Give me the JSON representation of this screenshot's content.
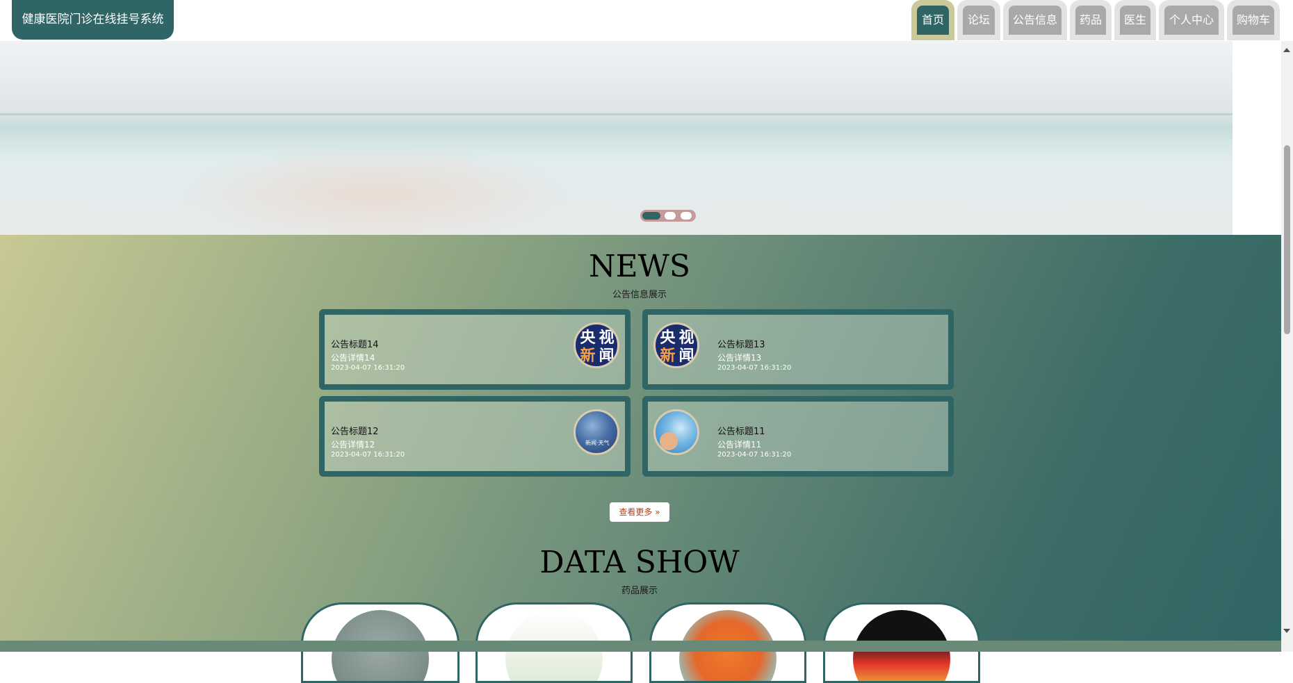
{
  "header": {
    "brand": "健康医院门诊在线挂号系统",
    "nav": [
      {
        "label": "首页",
        "active": true
      },
      {
        "label": "论坛",
        "active": false
      },
      {
        "label": "公告信息",
        "active": false
      },
      {
        "label": "药品",
        "active": false
      },
      {
        "label": "医生",
        "active": false
      },
      {
        "label": "个人中心",
        "active": false
      },
      {
        "label": "购物车",
        "active": false
      }
    ]
  },
  "hero": {
    "slides": 3,
    "active_slide": 1
  },
  "news": {
    "title": "NEWS",
    "subtitle": "公告信息展示",
    "items": [
      {
        "title": "公告标题14",
        "detail": "公告详情14",
        "time": "2023-04-07 16:31:20",
        "image": "cctv-news-logo"
      },
      {
        "title": "公告标题13",
        "detail": "公告详情13",
        "time": "2023-04-07 16:31:20",
        "image": "cctv-news-logo"
      },
      {
        "title": "公告标题12",
        "detail": "公告详情12",
        "time": "2023-04-07 16:31:20",
        "image": "weather-news-logo"
      },
      {
        "title": "公告标题11",
        "detail": "公告详情11",
        "time": "2023-04-07 16:31:20",
        "image": "sea-news-image"
      }
    ],
    "cctv_glyphs": [
      "央",
      "视",
      "新",
      "闻"
    ],
    "weather_label": "新闻·天气",
    "more_label": "查看更多 »"
  },
  "data_show": {
    "title": "DATA SHOW",
    "subtitle": "药品展示",
    "products": [
      "product-image-1",
      "product-image-2",
      "product-image-3",
      "product-image-4"
    ]
  },
  "colors": {
    "primary": "#2f6564",
    "accent": "#c9c99a",
    "inactive_nav": "#a9a9a9"
  }
}
